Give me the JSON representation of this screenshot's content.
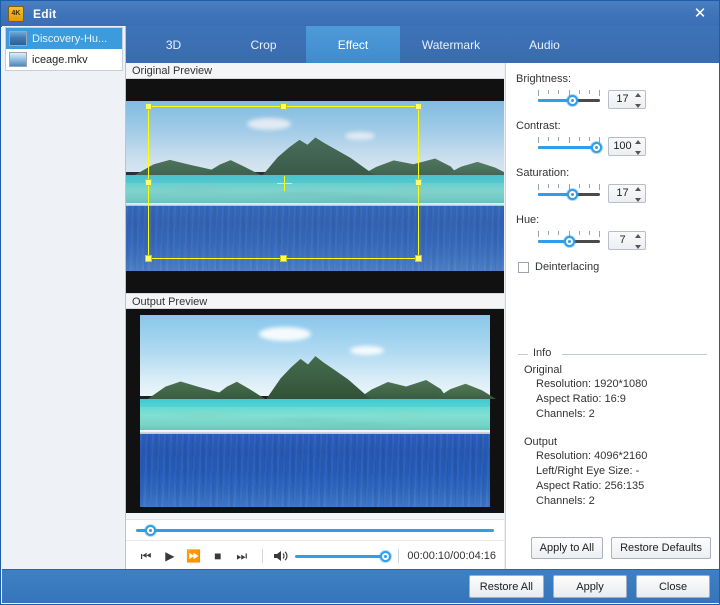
{
  "window": {
    "title": "Edit",
    "app_icon": "film-4k-icon",
    "close_label": "✕",
    "accent_color": "#3a6eb5",
    "slider_color": "#2f9ee8",
    "crop_color": "#ffff00"
  },
  "sidebar": {
    "files": [
      {
        "name": "Discovery-Hu...",
        "selected": true
      },
      {
        "name": "iceage.mkv",
        "selected": false
      }
    ]
  },
  "tabs": [
    {
      "label": "3D",
      "active": false
    },
    {
      "label": "Crop",
      "active": false
    },
    {
      "label": "Effect",
      "active": true
    },
    {
      "label": "Watermark",
      "active": false
    },
    {
      "label": "Audio",
      "active": false
    }
  ],
  "previews": {
    "original_title": "Original Preview",
    "output_title": "Output Preview"
  },
  "transport": {
    "seek_percent": 4,
    "volume_percent": 100,
    "time": "00:00:10/00:04:16",
    "buttons": {
      "previous": "⏮",
      "play": "▶",
      "forward": "⏩",
      "stop": "■",
      "next": "⏭",
      "volume": "volume-icon"
    }
  },
  "effects": [
    {
      "key": "brightness",
      "label": "Brightness:",
      "value": "17",
      "percent": 55
    },
    {
      "key": "contrast",
      "label": "Contrast:",
      "value": "100",
      "percent": 100
    },
    {
      "key": "saturation",
      "label": "Saturation:",
      "value": "17",
      "percent": 55
    },
    {
      "key": "hue",
      "label": "Hue:",
      "value": "7",
      "percent": 50
    }
  ],
  "deinterlacing": {
    "label": "Deinterlacing",
    "checked": false
  },
  "info": {
    "legend": "Info",
    "original_heading": "Original",
    "original_lines": [
      "Resolution: 1920*1080",
      "Aspect Ratio: 16:9",
      "Channels: 2"
    ],
    "output_heading": "Output",
    "output_lines": [
      "Resolution: 4096*2160",
      "Left/Right Eye Size: -",
      "Aspect Ratio: 256:135",
      "Channels: 2"
    ]
  },
  "panel_buttons": {
    "apply_to_all": "Apply to All",
    "restore_defaults": "Restore Defaults"
  },
  "bottom_buttons": {
    "restore_all": "Restore All",
    "apply": "Apply",
    "close": "Close"
  }
}
